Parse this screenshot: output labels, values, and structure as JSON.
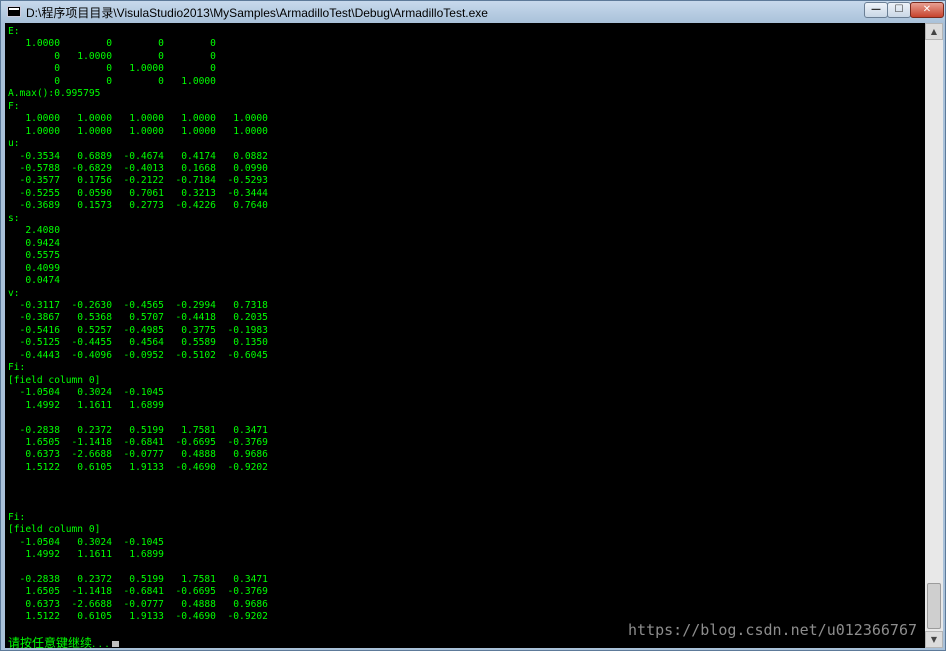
{
  "window": {
    "title": "D:\\程序项目目录\\VisulaStudio2013\\MySamples\\ArmadilloTest\\Debug\\ArmadilloTest.exe",
    "minimize_glyph": "—",
    "maximize_glyph": "☐",
    "close_glyph": "✕"
  },
  "console": {
    "output": "E:\n   1.0000        0        0        0\n        0   1.0000        0        0\n        0        0   1.0000        0\n        0        0        0   1.0000\nA.max():0.995795\nF:\n   1.0000   1.0000   1.0000   1.0000   1.0000\n   1.0000   1.0000   1.0000   1.0000   1.0000\nu:\n  -0.3534   0.6889  -0.4674   0.4174   0.0882\n  -0.5788  -0.6829  -0.4013   0.1668   0.0990\n  -0.3577   0.1756  -0.2122  -0.7184  -0.5293\n  -0.5255   0.0590   0.7061   0.3213  -0.3444\n  -0.3689   0.1573   0.2773  -0.4226   0.7640\ns:\n   2.4080\n   0.9424\n   0.5575\n   0.4099\n   0.0474\nv:\n  -0.3117  -0.2630  -0.4565  -0.2994   0.7318\n  -0.3867   0.5368   0.5707  -0.4418   0.2035\n  -0.5416   0.5257  -0.4985   0.3775  -0.1983\n  -0.5125  -0.4455   0.4564   0.5589   0.1350\n  -0.4443  -0.4096  -0.0952  -0.5102  -0.6045\nFi:\n[field column 0]\n  -1.0504   0.3024  -0.1045\n   1.4992   1.1611   1.6899\n\n  -0.2838   0.2372   0.5199   1.7581   0.3471\n   1.6505  -1.1418  -0.6841  -0.6695  -0.3769\n   0.6373  -2.6688  -0.0777   0.4888   0.9686\n   1.5122   0.6105   1.9133  -0.4690  -0.9202\n\n\n\nFi:\n[field column 0]\n  -1.0504   0.3024  -0.1045\n   1.4992   1.1611   1.6899\n\n  -0.2838   0.2372   0.5199   1.7581   0.3471\n   1.6505  -1.1418  -0.6841  -0.6695  -0.3769\n   0.6373  -2.6688  -0.0777   0.4888   0.9686\n   1.5122   0.6105   1.9133  -0.4690  -0.9202",
    "prompt": "请按任意键继续. . ."
  },
  "watermark": "https://blog.csdn.net/u012366767",
  "scrollbar": {
    "up_glyph": "▲",
    "down_glyph": "▼"
  },
  "colors": {
    "console_bg": "#000000",
    "console_text": "#00ff00",
    "titlebar": "#a9c1d9",
    "close_button": "#c7432d"
  }
}
